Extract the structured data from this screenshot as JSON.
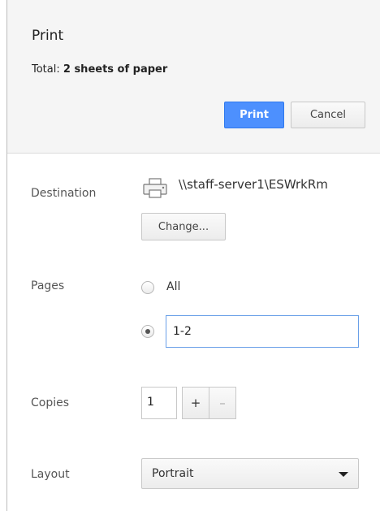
{
  "header": {
    "title": "Print",
    "summary_prefix": "Total: ",
    "summary_bold": "2 sheets of paper",
    "print_button": "Print",
    "cancel_button": "Cancel"
  },
  "destination": {
    "label": "Destination",
    "printer": "\\\\staff-server1\\ESWrkRm",
    "change_button": "Change..."
  },
  "pages": {
    "label": "Pages",
    "options": [
      {
        "label": "All",
        "selected": false
      },
      {
        "label": "",
        "selected": true
      }
    ],
    "custom_value": "1-2"
  },
  "copies": {
    "label": "Copies",
    "value": "1",
    "increment": "+",
    "decrement": "–"
  },
  "layout": {
    "label": "Layout",
    "selected": "Portrait"
  },
  "colors": {
    "accent": "#4d90fe",
    "header_bg": "#f5f5f5",
    "input_focus": "#6aa0e8"
  }
}
